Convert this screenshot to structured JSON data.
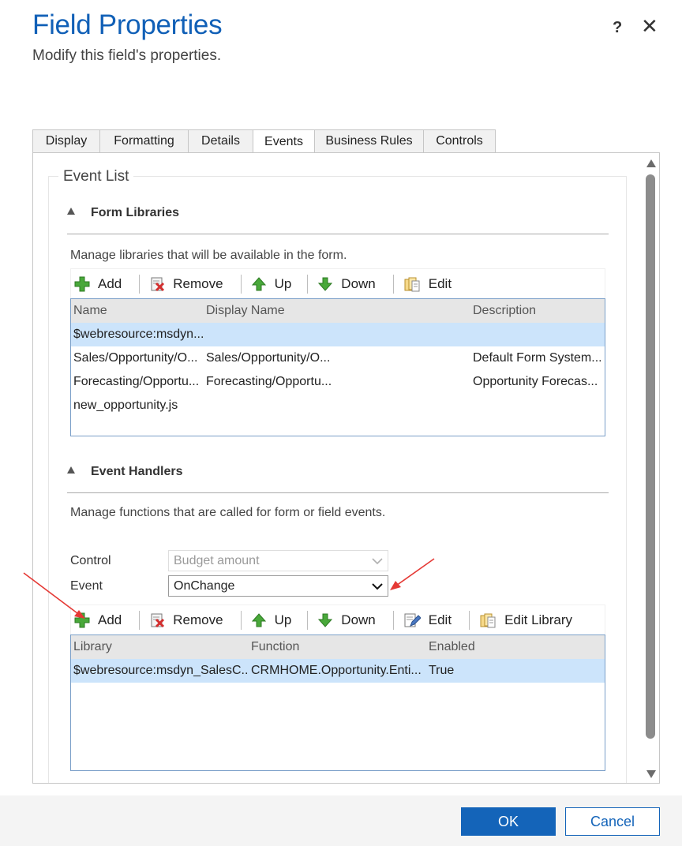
{
  "dialog": {
    "title": "Field Properties",
    "subtitle": "Modify this field's properties.",
    "help_glyph": "?",
    "close_glyph": "✕"
  },
  "tabs": [
    {
      "label": "Display"
    },
    {
      "label": "Formatting"
    },
    {
      "label": "Details"
    },
    {
      "label": "Events",
      "active": true
    },
    {
      "label": "Business Rules"
    },
    {
      "label": "Controls"
    }
  ],
  "event_list": {
    "legend": "Event List",
    "form_libraries": {
      "heading": "Form Libraries",
      "description": "Manage libraries that will be available in the form.",
      "toolbar": {
        "add": "Add",
        "remove": "Remove",
        "up": "Up",
        "down": "Down",
        "edit": "Edit"
      },
      "columns": [
        "Name",
        "Display Name",
        "Description"
      ],
      "rows": [
        {
          "name": "$webresource:msdyn...",
          "display_name": "",
          "description": "",
          "selected": true
        },
        {
          "name": "Sales/Opportunity/O...",
          "display_name": "Sales/Opportunity/O...",
          "description": "Default Form System..."
        },
        {
          "name": "Forecasting/Opportu...",
          "display_name": "Forecasting/Opportu...",
          "description": "Opportunity Forecas..."
        },
        {
          "name": "new_opportunity.js",
          "display_name": "",
          "description": ""
        }
      ]
    },
    "event_handlers": {
      "heading": "Event Handlers",
      "description": "Manage functions that are called for form or field events.",
      "control_label": "Control",
      "control_value": "Budget amount",
      "event_label": "Event",
      "event_value": "OnChange",
      "toolbar": {
        "add": "Add",
        "remove": "Remove",
        "up": "Up",
        "down": "Down",
        "edit": "Edit",
        "edit_library": "Edit Library"
      },
      "columns": [
        "Library",
        "Function",
        "Enabled"
      ],
      "rows": [
        {
          "library": "$webresource:msdyn_SalesC...",
          "function": "CRMHOME.Opportunity.Enti...",
          "enabled": "True",
          "selected": true
        }
      ]
    }
  },
  "footer": {
    "ok": "OK",
    "cancel": "Cancel"
  },
  "colors": {
    "accent": "#1160b7",
    "selection": "#cce4fb",
    "annotation_arrow": "#e53935"
  }
}
